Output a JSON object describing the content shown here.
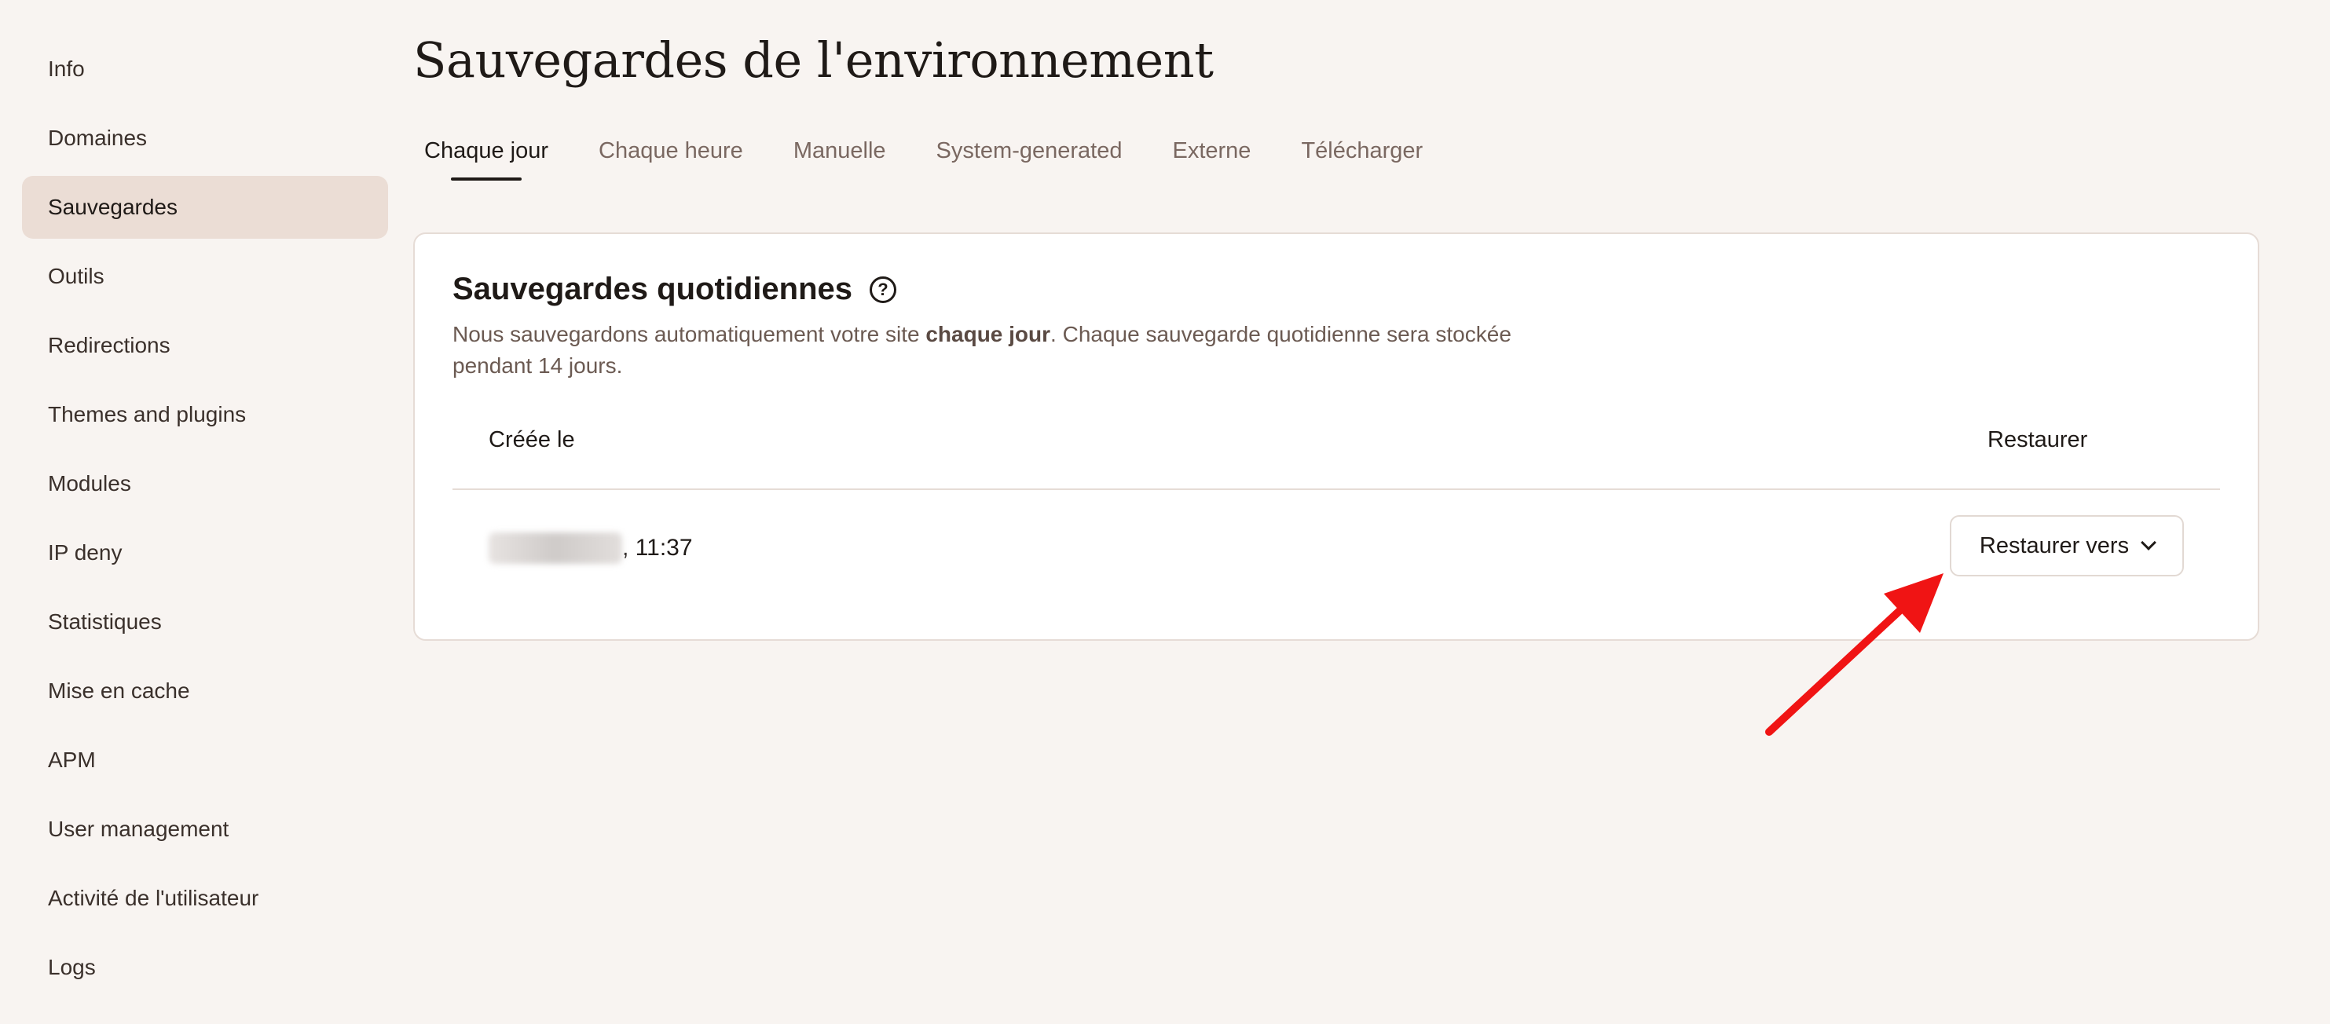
{
  "sidebar": {
    "items": [
      {
        "label": "Info"
      },
      {
        "label": "Domaines"
      },
      {
        "label": "Sauvegardes",
        "active": true
      },
      {
        "label": "Outils"
      },
      {
        "label": "Redirections"
      },
      {
        "label": "Themes and plugins"
      },
      {
        "label": "Modules"
      },
      {
        "label": "IP deny"
      },
      {
        "label": "Statistiques"
      },
      {
        "label": "Mise en cache"
      },
      {
        "label": "APM"
      },
      {
        "label": "User management"
      },
      {
        "label": "Activité de l'utilisateur"
      },
      {
        "label": "Logs"
      }
    ]
  },
  "page": {
    "title": "Sauvegardes de l'environnement"
  },
  "tabs": [
    {
      "label": "Chaque jour",
      "active": true
    },
    {
      "label": "Chaque heure"
    },
    {
      "label": "Manuelle"
    },
    {
      "label": "System-generated"
    },
    {
      "label": "Externe"
    },
    {
      "label": "Télécharger"
    }
  ],
  "card": {
    "title": "Sauvegardes quotidiennes",
    "help_icon": "question-circle-icon",
    "desc_before": "Nous sauvegardons automatiquement votre site ",
    "desc_bold": "chaque jour",
    "desc_after": ". Chaque sauvegarde quotidienne sera stockée pendant 14 jours.",
    "columns": {
      "created": "Créée le",
      "restore": "Restaurer"
    },
    "row": {
      "time_suffix": ", 11:37",
      "restore_button": "Restaurer vers",
      "chevron_icon": "chevron-down-icon"
    }
  },
  "colors": {
    "background": "#f8f4f1",
    "active_sidebar": "#ebddd5",
    "annotation_arrow": "#f01414"
  }
}
